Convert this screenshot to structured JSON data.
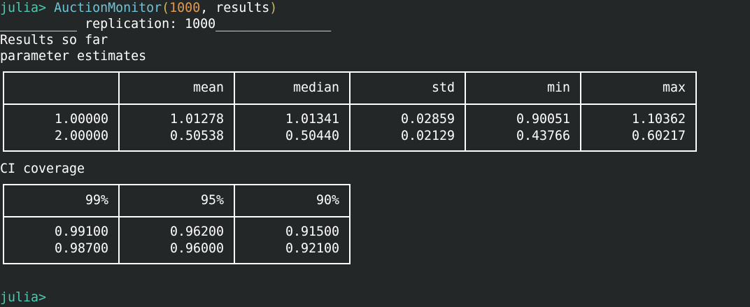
{
  "header": {
    "prompt": "julia>",
    "command": {
      "function": "AuctionMonitor",
      "open_paren": "(",
      "arg_number": "1000",
      "rest": ", results",
      "close_paren": ")"
    }
  },
  "output": {
    "replication_line": "__________ replication: 1000_______________",
    "results_heading": "Results so far",
    "param_heading": "parameter estimates",
    "ci_heading": "CI coverage"
  },
  "param_table": {
    "columns": [
      "",
      "mean",
      "median",
      "std",
      "min",
      "max"
    ],
    "rows": [
      [
        "1.00000",
        "1.01278",
        "1.01341",
        "0.02859",
        "0.90051",
        "1.10362"
      ],
      [
        "2.00000",
        "0.50538",
        "0.50440",
        "0.02129",
        "0.43766",
        "0.60217"
      ]
    ]
  },
  "ci_table": {
    "columns": [
      "99%",
      "95%",
      "90%"
    ],
    "rows": [
      [
        "0.99100",
        "0.96200",
        "0.91500"
      ],
      [
        "0.98700",
        "0.96000",
        "0.92100"
      ]
    ]
  },
  "footer": {
    "prompt": "julia>"
  },
  "colors": {
    "background": "#232728",
    "prompt": "#4ec9b0",
    "function_name": "#6fc3d6",
    "number_literal": "#e09a4f",
    "parenthesis": "#c9b65a",
    "text": "#ffffff"
  }
}
